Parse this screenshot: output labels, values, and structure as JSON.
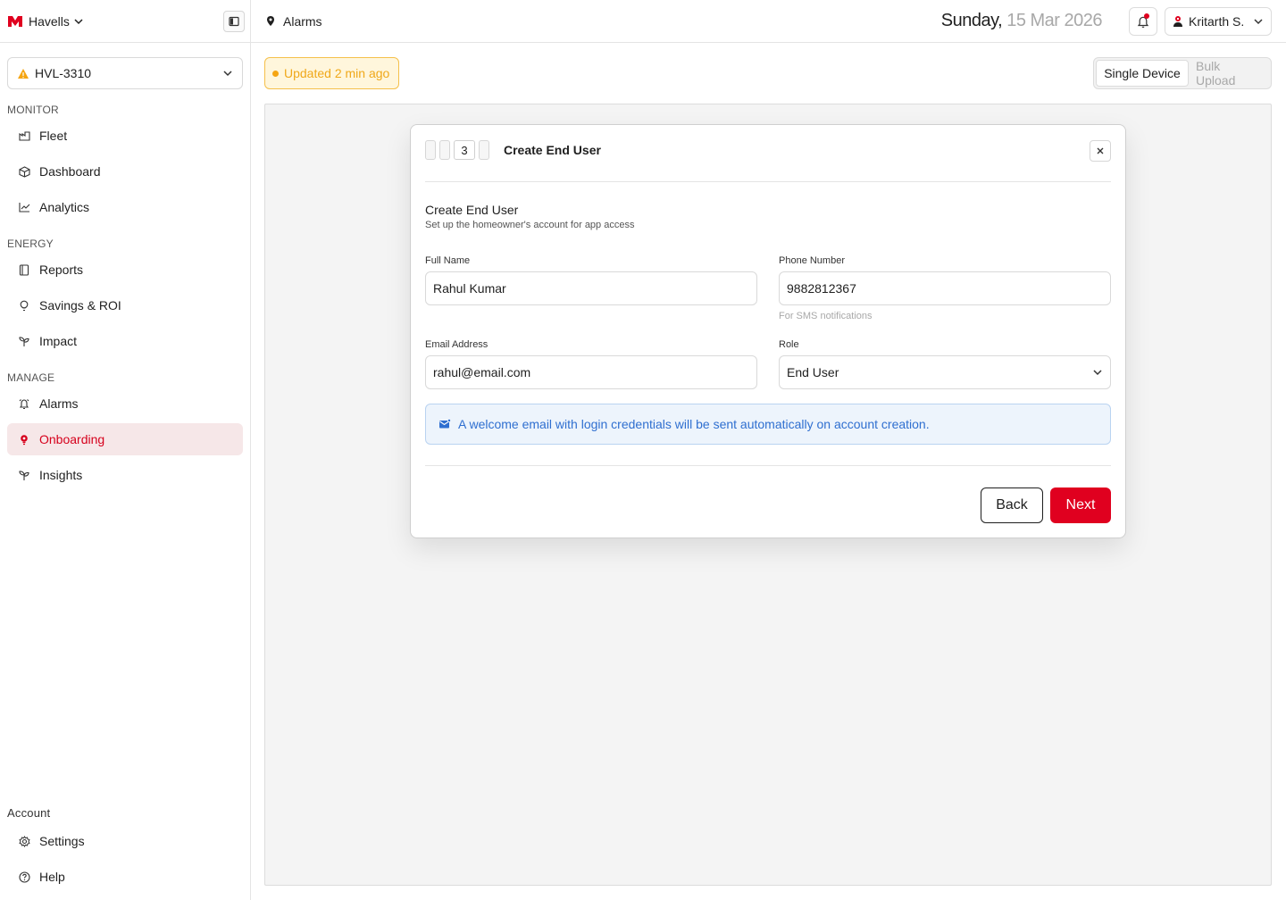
{
  "brand": {
    "name": "Havells"
  },
  "device": {
    "id": "HVL-3310"
  },
  "sidebar": {
    "sections": [
      {
        "title": "MONITOR"
      },
      {
        "title": "ENERGY"
      },
      {
        "title": "MANAGE"
      },
      {
        "title": "Account"
      }
    ],
    "items": [
      {
        "label": "Fleet",
        "icon": "fleet-icon"
      },
      {
        "label": "Dashboard",
        "icon": "cube-icon"
      },
      {
        "label": "Analytics",
        "icon": "chart-icon"
      },
      {
        "label": "Reports",
        "icon": "report-icon"
      },
      {
        "label": "Savings & ROI",
        "icon": "bulb-icon"
      },
      {
        "label": "Impact",
        "icon": "sprout-icon"
      },
      {
        "label": "Alarms",
        "icon": "bell-icon"
      },
      {
        "label": "Onboarding",
        "icon": "bulb-icon",
        "active": true
      },
      {
        "label": "Insights",
        "icon": "sprout-icon"
      },
      {
        "label": "Settings",
        "icon": "gear-icon"
      },
      {
        "label": "Help",
        "icon": "help-icon"
      }
    ]
  },
  "topbar": {
    "breadcrumb": "Alarms",
    "date_day": "Sunday,",
    "date_rest": " 15 Mar 2026",
    "user": "Kritarth S."
  },
  "status": {
    "updated": "Updated 2 min ago"
  },
  "mode_toggle": {
    "single": "Single Device",
    "bulk": "Bulk Upload"
  },
  "modal": {
    "current_step": "3",
    "title": "Create End User",
    "form_title": "Create End User",
    "form_subtitle": "Set up the homeowner's account for app access",
    "full_name_label": "Full Name",
    "full_name_value": "Rahul Kumar",
    "phone_label": "Phone Number",
    "phone_value": "9882812367",
    "phone_helper": "For SMS notifications",
    "email_label": "Email Address",
    "email_value": "rahul@email.com",
    "role_label": "Role",
    "role_value": "End User",
    "info": "A welcome email with login credentials will be sent automatically on account creation.",
    "back": "Back",
    "next": "Next"
  },
  "colors": {
    "accent": "#e0001f",
    "active_nav_bg": "#f6e7e8",
    "warning": "#f5a512",
    "info_text": "#2f6fd0"
  }
}
